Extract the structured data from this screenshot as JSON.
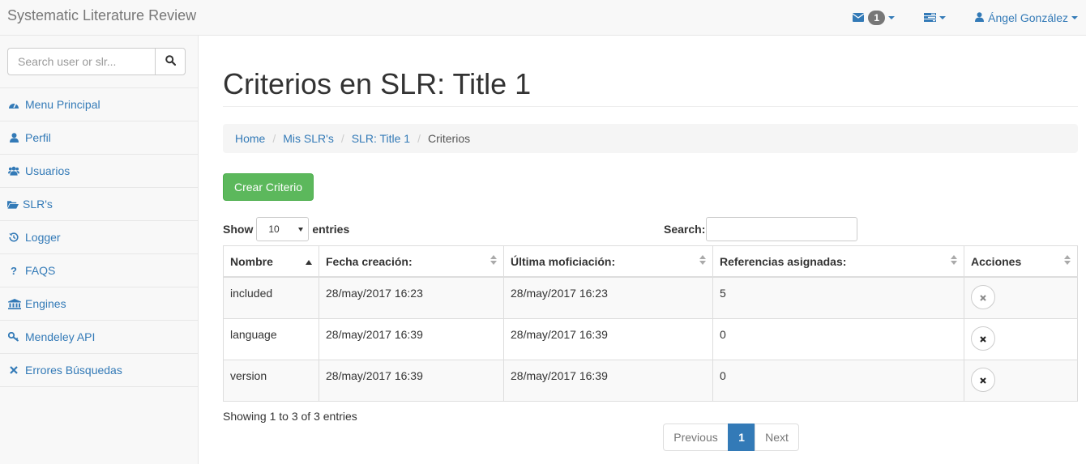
{
  "navbar": {
    "brand": "Systematic Literature Review",
    "messages_count": "1",
    "user_name": "Ángel González"
  },
  "sidebar": {
    "search_placeholder": "Search user or slr...",
    "items": [
      {
        "label": "Menu Principal",
        "icon": "dashboard-icon"
      },
      {
        "label": "Perfil",
        "icon": "user-icon"
      },
      {
        "label": "Usuarios",
        "icon": "users-icon"
      },
      {
        "label": "SLR's",
        "icon": "folder-open-icon"
      },
      {
        "label": "Logger",
        "icon": "history-icon"
      },
      {
        "label": "FAQS",
        "icon": "question-icon"
      },
      {
        "label": "Engines",
        "icon": "bank-icon"
      },
      {
        "label": "Mendeley API",
        "icon": "key-icon"
      },
      {
        "label": "Errores Búsquedas",
        "icon": "times-icon"
      }
    ]
  },
  "page": {
    "title": "Criterios en SLR: Title 1",
    "breadcrumb": [
      "Home",
      "Mis SLR's",
      "SLR: Title 1",
      "Criterios"
    ],
    "create_button": "Crear Criterio"
  },
  "table": {
    "show_label": "Show",
    "page_length": "10",
    "entries_label": "entries",
    "search_label": "Search:",
    "search_value": "",
    "columns": [
      "Nombre",
      "Fecha creación:",
      "Última moficiación:",
      "Referencias asignadas:",
      "Acciones"
    ],
    "rows": [
      [
        "included",
        "28/may/2017 16:23",
        "28/may/2017 16:23",
        "5"
      ],
      [
        "language",
        "28/may/2017 16:39",
        "28/may/2017 16:39",
        "0"
      ],
      [
        "version",
        "28/may/2017 16:39",
        "28/may/2017 16:39",
        "0"
      ]
    ],
    "info": "Showing 1 to 3 of 3 entries",
    "pagination": {
      "previous": "Previous",
      "current": "1",
      "next": "Next"
    }
  },
  "colors": {
    "accent": "#337ab7",
    "success": "#5cb85c",
    "badge": "#777777"
  }
}
